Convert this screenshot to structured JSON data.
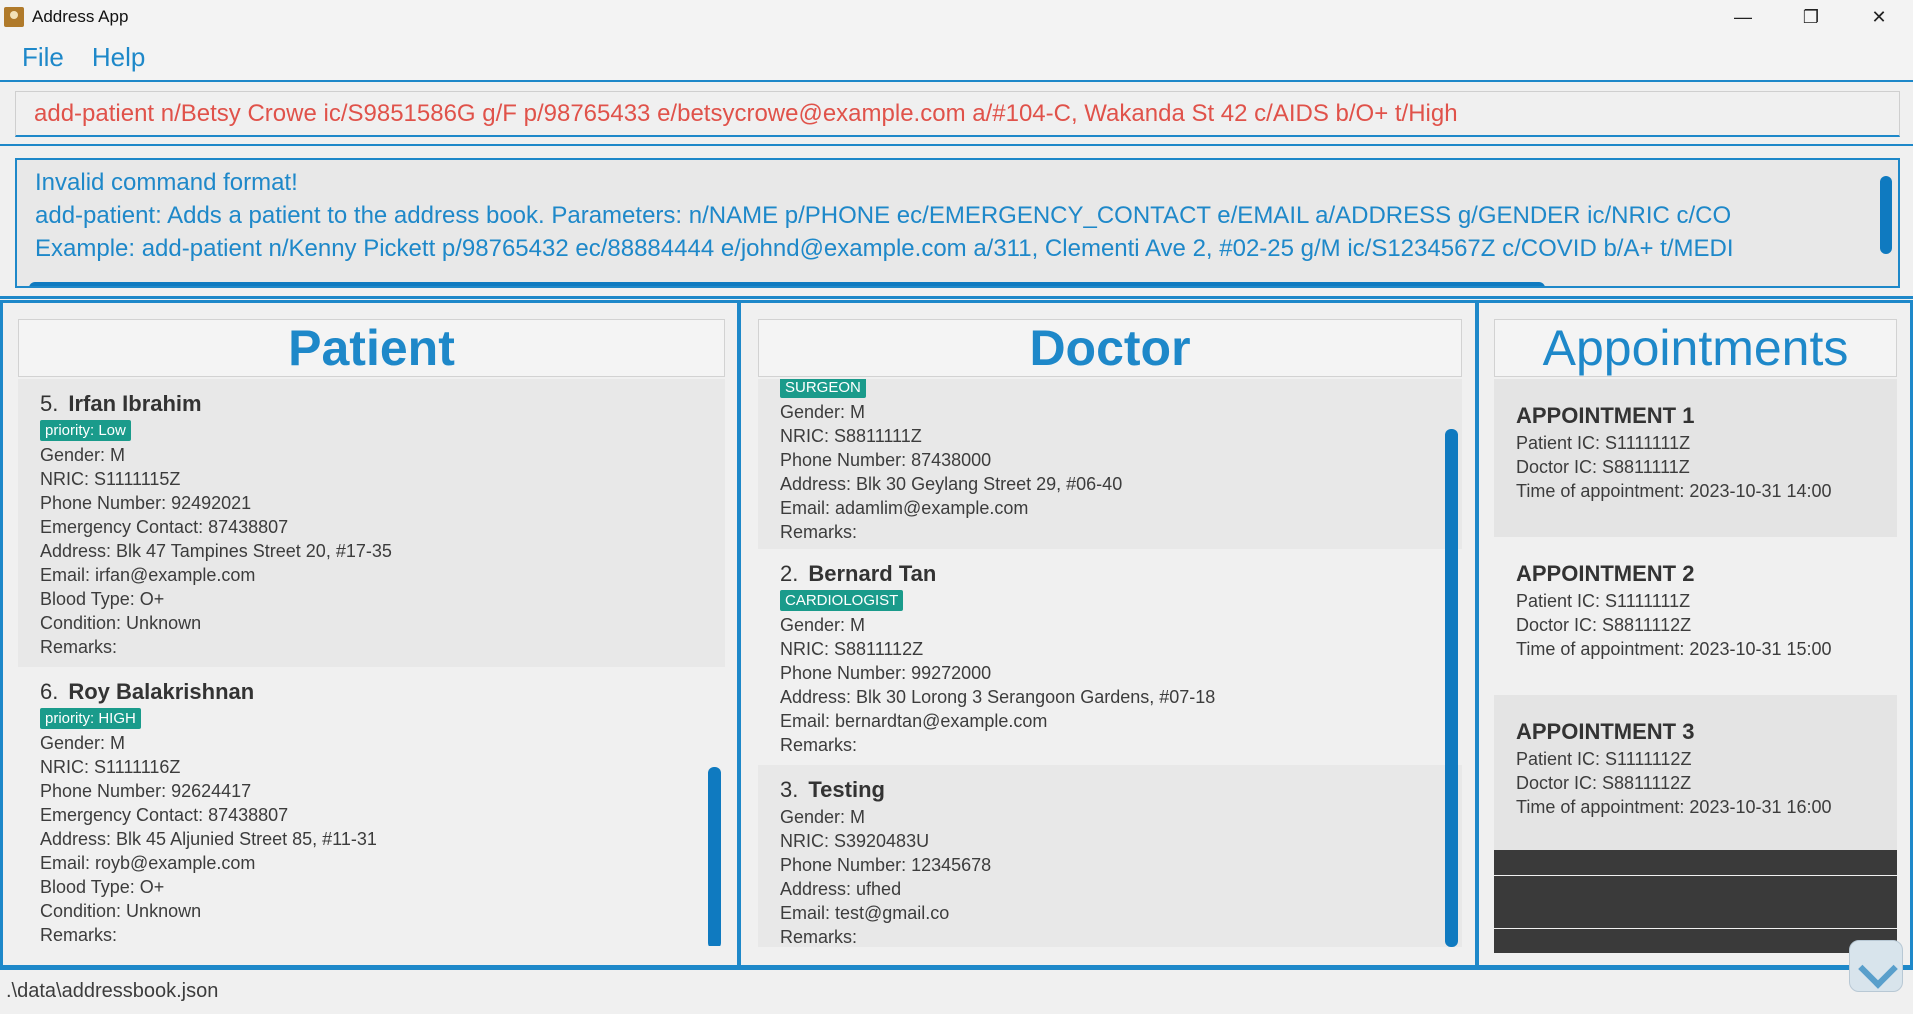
{
  "window": {
    "title": "Address App"
  },
  "menu": {
    "file": "File",
    "help": "Help"
  },
  "command": {
    "value": "add-patient n/Betsy Crowe ic/S9851586G g/F p/98765433 e/betsycrowe@example.com a/#104-C, Wakanda St 42 c/AIDS b/O+ t/High"
  },
  "result": {
    "lines": [
      "Invalid command format!",
      "add-patient: Adds a patient to the address book. Parameters: n/NAME p/PHONE ec/EMERGENCY_CONTACT e/EMAIL a/ADDRESS g/GENDER ic/NRIC c/CO",
      "Example: add-patient n/Kenny Pickett p/98765432 ec/88884444 e/johnd@example.com a/311, Clementi Ave 2, #02-25 g/M ic/S1234567Z c/COVID b/A+ t/MEDI"
    ]
  },
  "patient_panel": {
    "header": "Patient",
    "cards": [
      {
        "index": "5.",
        "name": "Irfan Ibrahim",
        "tag": "priority: Low",
        "fields": [
          "Gender: M",
          "NRIC: S1111115Z",
          "Phone Number: 92492021",
          "Emergency Contact: 87438807",
          "Address: Blk 47 Tampines Street 20, #17-35",
          "Email: irfan@example.com",
          "Blood Type: O+",
          "Condition: Unknown",
          "Remarks:"
        ]
      },
      {
        "index": "6.",
        "name": "Roy Balakrishnan",
        "tag": "priority: HIGH",
        "fields": [
          "Gender: M",
          "NRIC: S1111116Z",
          "Phone Number: 92624417",
          "Emergency Contact: 87438807",
          "Address: Blk 45 Aljunied Street 85, #11-31",
          "Email: royb@example.com",
          "Blood Type: O+",
          "Condition: Unknown",
          "Remarks:"
        ]
      }
    ]
  },
  "doctor_panel": {
    "header": "Doctor",
    "cards": [
      {
        "index": "",
        "name": "",
        "tag": "SURGEON",
        "fields": [
          "Gender: M",
          "NRIC: S8811111Z",
          "Phone Number: 87438000",
          "Address: Blk 30 Geylang Street 29, #06-40",
          "Email: adamlim@example.com",
          "Remarks:"
        ]
      },
      {
        "index": "2.",
        "name": "Bernard Tan",
        "tag": "CARDIOLOGIST",
        "fields": [
          "Gender: M",
          "NRIC: S8811112Z",
          "Phone Number: 99272000",
          "Address: Blk 30 Lorong 3 Serangoon Gardens, #07-18",
          "Email: bernardtan@example.com",
          "Remarks:"
        ]
      },
      {
        "index": "3.",
        "name": "Testing",
        "tag": "",
        "fields": [
          "Gender: M",
          "NRIC: S3920483U",
          "Phone Number: 12345678",
          "Address: ufhed",
          "Email: test@gmail.co",
          "Remarks:"
        ]
      }
    ]
  },
  "appointment_panel": {
    "header": "Appointments",
    "items": [
      {
        "title": "APPOINTMENT 1",
        "fields": [
          "Patient IC: S1111111Z",
          "Doctor IC: S8811111Z",
          "Time of appointment: 2023-10-31 14:00"
        ]
      },
      {
        "title": "APPOINTMENT 2",
        "fields": [
          "Patient IC: S1111111Z",
          "Doctor IC: S8811112Z",
          "Time of appointment: 2023-10-31 15:00"
        ]
      },
      {
        "title": "APPOINTMENT 3",
        "fields": [
          "Patient IC: S1111112Z",
          "Doctor IC: S8811112Z",
          "Time of appointment: 2023-10-31 16:00"
        ]
      }
    ]
  },
  "status": {
    "path": ".\\data\\addressbook.json"
  }
}
